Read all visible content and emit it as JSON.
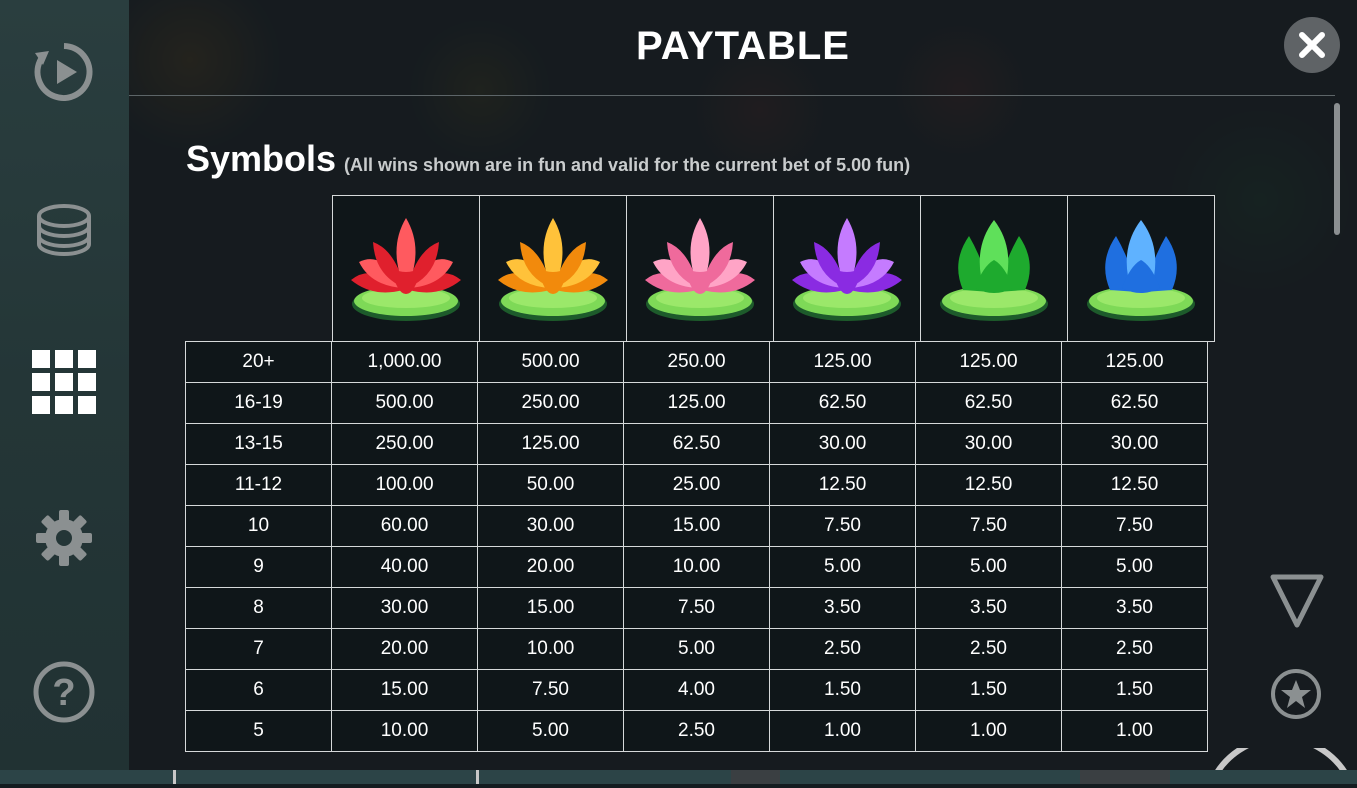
{
  "title": "PAYTABLE",
  "section": {
    "heading": "Symbols",
    "note": "(All wins shown are in fun and valid for the current bet of 5.00 fun)"
  },
  "sidebar": [
    {
      "name": "autoplay-icon"
    },
    {
      "name": "bet-coins-icon"
    },
    {
      "name": "paytable-grid-icon"
    },
    {
      "name": "settings-gear-icon"
    },
    {
      "name": "help-icon"
    }
  ],
  "symbols": [
    {
      "name": "red-lotus",
      "petal": "#e0202d",
      "petal_light": "#ff5a5f"
    },
    {
      "name": "orange-lotus",
      "petal": "#f28a0c",
      "petal_light": "#ffc23a"
    },
    {
      "name": "pink-lotus",
      "petal": "#ef6a9c",
      "petal_light": "#ffa4c6"
    },
    {
      "name": "purple-lotus",
      "petal": "#8a2be2",
      "petal_light": "#c57bff"
    },
    {
      "name": "green-lotus-bud",
      "petal": "#1eaa2e",
      "petal_light": "#5fe05a"
    },
    {
      "name": "blue-lotus-bud",
      "petal": "#1f6fe0",
      "petal_light": "#5fb2ff"
    }
  ],
  "rows": [
    {
      "count": "20+",
      "values": [
        "1,000.00",
        "500.00",
        "250.00",
        "125.00",
        "125.00",
        "125.00"
      ]
    },
    {
      "count": "16-19",
      "values": [
        "500.00",
        "250.00",
        "125.00",
        "62.50",
        "62.50",
        "62.50"
      ]
    },
    {
      "count": "13-15",
      "values": [
        "250.00",
        "125.00",
        "62.50",
        "30.00",
        "30.00",
        "30.00"
      ]
    },
    {
      "count": "11-12",
      "values": [
        "100.00",
        "50.00",
        "25.00",
        "12.50",
        "12.50",
        "12.50"
      ]
    },
    {
      "count": "10",
      "values": [
        "60.00",
        "30.00",
        "15.00",
        "7.50",
        "7.50",
        "7.50"
      ]
    },
    {
      "count": "9",
      "values": [
        "40.00",
        "20.00",
        "10.00",
        "5.00",
        "5.00",
        "5.00"
      ]
    },
    {
      "count": "8",
      "values": [
        "30.00",
        "15.00",
        "7.50",
        "3.50",
        "3.50",
        "3.50"
      ]
    },
    {
      "count": "7",
      "values": [
        "20.00",
        "10.00",
        "5.00",
        "2.50",
        "2.50",
        "2.50"
      ]
    },
    {
      "count": "6",
      "values": [
        "15.00",
        "7.50",
        "4.00",
        "1.50",
        "1.50",
        "1.50"
      ]
    },
    {
      "count": "5",
      "values": [
        "10.00",
        "5.00",
        "2.50",
        "1.00",
        "1.00",
        "1.00"
      ]
    }
  ],
  "colors": {
    "sidebar": "#2a3e3f",
    "overlay": "#141a1e",
    "table_border": "#d6d9da",
    "icon_grey": "#8b9091",
    "close_button": "#5f6366"
  }
}
